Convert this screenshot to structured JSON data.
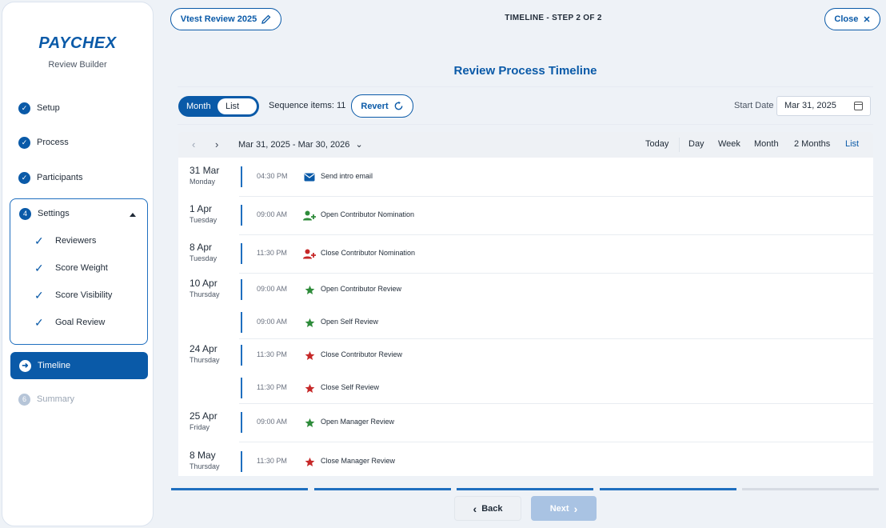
{
  "sidebar": {
    "logo": "PAYCHEX",
    "subtitle": "Review Builder",
    "steps": [
      {
        "label": "Setup",
        "marker": "✓"
      },
      {
        "label": "Process",
        "marker": "✓"
      },
      {
        "label": "Participants",
        "marker": "✓"
      },
      {
        "label": "Settings",
        "marker": "4"
      },
      {
        "label": "Timeline",
        "marker": "➜"
      },
      {
        "label": "Summary",
        "marker": "6"
      }
    ],
    "settings_items": [
      "Reviewers",
      "Score Weight",
      "Score Visibility",
      "Goal Review"
    ],
    "check_glyph": "✓",
    "active_step": "Timeline"
  },
  "header": {
    "review_name": "Vtest Review 2025",
    "step_title": "TIMELINE - STEP 2 OF 2",
    "close_label": "Close",
    "close_glyph": "✕"
  },
  "page": {
    "heading": "Review Process Timeline"
  },
  "controls": {
    "toggle_month": "Month",
    "toggle_list": "List",
    "toggle_selected": "List",
    "sequence_items": "Sequence items: 11",
    "revert_label": "Revert",
    "start_date_label": "Start Date",
    "start_date_value": "Mar 31, 2025"
  },
  "calendar": {
    "prev_glyph": "‹",
    "next_glyph": "›",
    "range": "Mar 31, 2025 - Mar 30, 2026",
    "range_caret": "⌄",
    "today": "Today",
    "views": [
      "Day",
      "Week",
      "Month",
      "2 Months",
      "List"
    ],
    "active_view": "List"
  },
  "events": [
    {
      "date": "31 Mar",
      "weekday": "Monday",
      "time": "04:30 PM",
      "title": "Send intro email",
      "icon": "mail-icon",
      "color": "#0a5aa8"
    },
    {
      "date": "1 Apr",
      "weekday": "Tuesday",
      "time": "09:00 AM",
      "title": "Open Contributor Nomination",
      "icon": "user-add-icon",
      "color": "#2e8b3a"
    },
    {
      "date": "8 Apr",
      "weekday": "Tuesday",
      "time": "11:30 PM",
      "title": "Close Contributor Nomination",
      "icon": "user-add-icon",
      "color": "#c62828"
    },
    {
      "date": "10 Apr",
      "weekday": "Thursday",
      "time": "09:00 AM",
      "title": "Open Contributor Review",
      "icon": "star-icon",
      "color": "#2e8b3a"
    },
    {
      "date": "",
      "weekday": "",
      "time": "09:00 AM",
      "title": "Open Self Review",
      "icon": "star-icon",
      "color": "#2e8b3a"
    },
    {
      "date": "24 Apr",
      "weekday": "Thursday",
      "time": "11:30 PM",
      "title": "Close Contributor Review",
      "icon": "star-icon",
      "color": "#c62828"
    },
    {
      "date": "",
      "weekday": "",
      "time": "11:30 PM",
      "title": "Close Self Review",
      "icon": "star-icon",
      "color": "#c62828"
    },
    {
      "date": "25 Apr",
      "weekday": "Friday",
      "time": "09:00 AM",
      "title": "Open Manager Review",
      "icon": "star-icon",
      "color": "#2e8b3a"
    },
    {
      "date": "8 May",
      "weekday": "Thursday",
      "time": "11:30 PM",
      "title": "Close Manager Review",
      "icon": "star-icon",
      "color": "#c62828"
    }
  ],
  "progress": {
    "segments_total": 5,
    "segments_complete": 4,
    "complete_color": "#1f6fbf",
    "pending_color": "#d6dbe3"
  },
  "footer": {
    "back_label": "Back",
    "next_label": "Next"
  }
}
